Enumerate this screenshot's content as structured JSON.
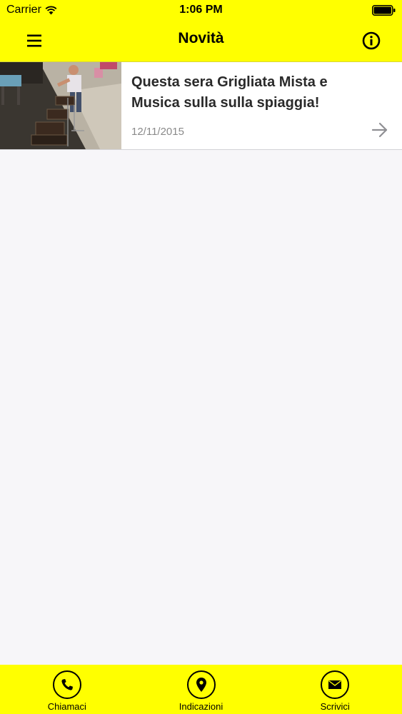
{
  "status_bar": {
    "carrier": "Carrier",
    "time": "1:06 PM"
  },
  "nav": {
    "title": "Novità",
    "left_icon": "hamburger-menu-icon",
    "right_icon": "info-icon"
  },
  "news": [
    {
      "title": "Questa sera Grigliata Mista e Musica sulla  sulla spiaggia!",
      "date": "12/11/2015",
      "thumbnail": "grill-photo",
      "action_icon": "arrow-right-icon"
    }
  ],
  "tabs": [
    {
      "label": "Chiamaci",
      "icon": "phone-icon"
    },
    {
      "label": "Indicazioni",
      "icon": "location-pin-icon"
    },
    {
      "label": "Scrivici",
      "icon": "envelope-icon"
    }
  ],
  "colors": {
    "accent": "#ffff00",
    "background": "#f7f6f9",
    "cell": "#ffffff",
    "date_text": "#8a8a8a"
  }
}
